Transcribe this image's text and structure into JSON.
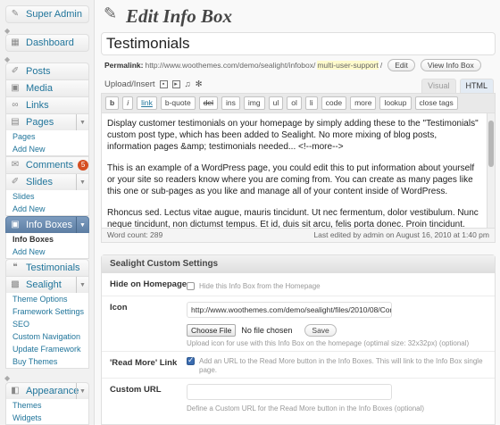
{
  "sidebar": {
    "super_admin": "Super Admin",
    "dashboard": "Dashboard",
    "posts": "Posts",
    "media": "Media",
    "links": "Links",
    "pages": "Pages",
    "pages_sub": [
      "Pages",
      "Add New"
    ],
    "comments": "Comments",
    "comments_count": "5",
    "slides": "Slides",
    "slides_sub": [
      "Slides",
      "Add New"
    ],
    "info_boxes": "Info Boxes",
    "info_boxes_sub": [
      "Info Boxes",
      "Add New"
    ],
    "testimonials": "Testimonials",
    "sealight": "Sealight",
    "sealight_sub": [
      "Theme Options",
      "Framework Settings",
      "SEO",
      "Custom Navigation",
      "Update Framework",
      "Buy Themes"
    ],
    "appearance": "Appearance",
    "appearance_sub": [
      "Themes",
      "Widgets"
    ]
  },
  "header": {
    "title": "Edit Info Box"
  },
  "post": {
    "title": "Testimonials",
    "permalink_label": "Permalink:",
    "permalink_base": "http://www.woothemes.com/demo/sealight/infobox/",
    "permalink_slug": "multi-user-support",
    "permalink_tail": "/",
    "edit_button": "Edit",
    "view_button": "View Info Box"
  },
  "editor": {
    "upload_label": "Upload/Insert",
    "tab_visual": "Visual",
    "tab_html": "HTML",
    "quicktags": [
      "b",
      "i",
      "link",
      "b-quote",
      "del",
      "ins",
      "img",
      "ul",
      "ol",
      "li",
      "code",
      "more",
      "lookup",
      "close tags"
    ],
    "paragraphs": [
      "Display customer testimonials on your homepage by simply adding these to the \"Testimonials\" custom post type, which has been added to Sealight. No more mixing of blog posts, information pages &amp; testimonials needed... <!--more-->",
      "This is an example of a WordPress page, you could edit this to put information about yourself or your site so readers know where you are coming from. You can create as many pages like this one or sub-pages as you like and manage all of your content inside of WordPress.",
      "Rhoncus sed. Lectus vitae augue, mauris tincidunt. Ut nec fermentum, dolor vestibulum. Nunc neque tincidunt, non dictumst tempus. Et id, duis sit arcu, felis porta donec. Proin tincidunt."
    ],
    "word_count": "Word count: 289",
    "last_edited": "Last edited by admin on August 16, 2010 at 1:40 pm"
  },
  "settings": {
    "title": "Sealight Custom Settings",
    "hide_label": "Hide on Homepage",
    "hide_desc": "Hide this Info Box from the Homepage",
    "hide_checked": false,
    "icon_label": "Icon",
    "icon_value": "http://www.woothemes.com/demo/sealight/files/2010/08/Com",
    "choose_file": "Choose File",
    "no_file": "No file chosen",
    "save": "Save",
    "icon_desc": "Upload icon for use with this Info Box on the homepage (optimal size: 32x32px) (optional)",
    "readmore_label": "'Read More' Link",
    "readmore_desc": "Add an URL to the Read More button in the Info Boxes. This will link to the Info Box single page.",
    "readmore_checked": true,
    "url_label": "Custom URL",
    "url_value": "",
    "url_desc": "Define a Custom URL for the Read More button in the Info Boxes (optional)"
  }
}
